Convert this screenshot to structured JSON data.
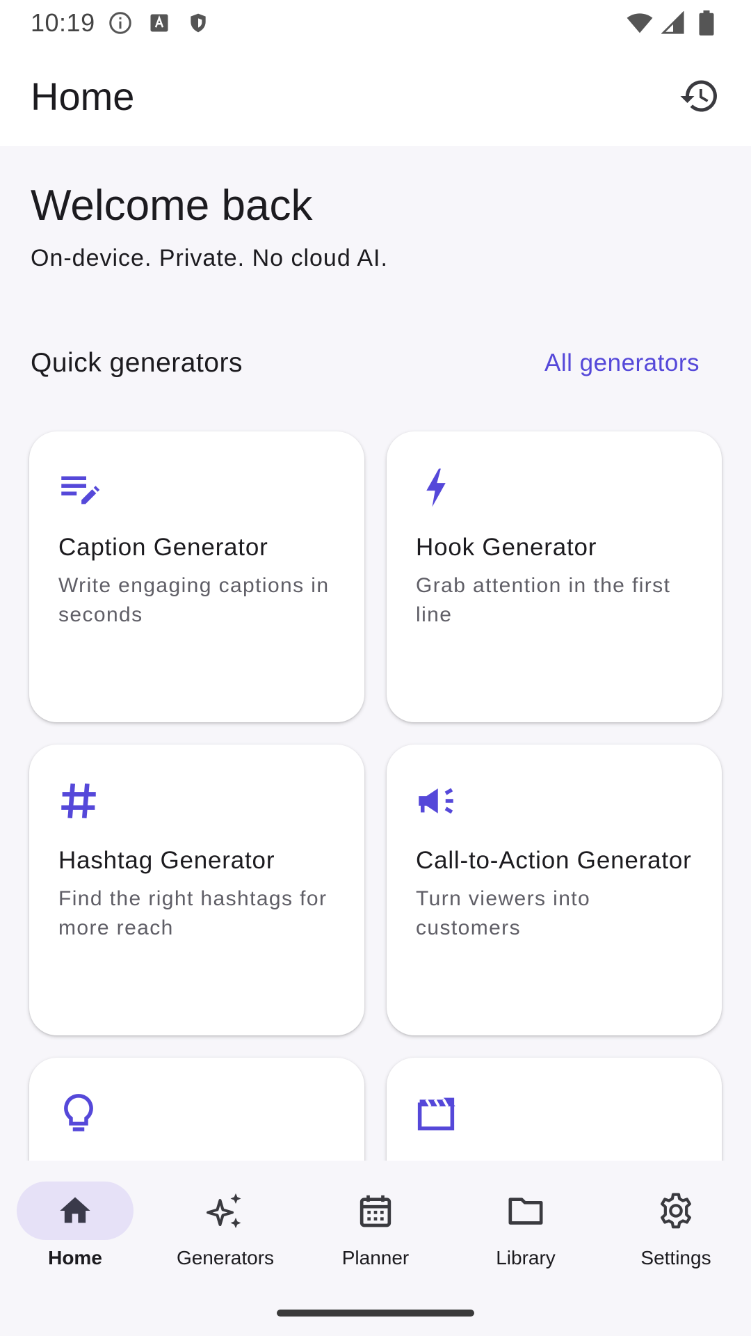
{
  "status_bar": {
    "time": "10:19",
    "icons": [
      "info-icon",
      "a-badge-icon",
      "shield-icon",
      "wifi-icon",
      "signal-icon",
      "battery-icon"
    ]
  },
  "app_bar": {
    "title": "Home",
    "action_icon": "history-icon"
  },
  "welcome": {
    "title": "Welcome back",
    "subtitle": "On-device. Private. No cloud AI."
  },
  "quick_generators": {
    "title": "Quick generators",
    "link": "All generators",
    "cards": [
      {
        "icon": "edit-notes-icon",
        "title": "Caption Generator",
        "description": "Write engaging captions in seconds"
      },
      {
        "icon": "bolt-icon",
        "title": "Hook Generator",
        "description": "Grab attention in the first line"
      },
      {
        "icon": "hashtag-icon",
        "title": "Hashtag Generator",
        "description": "Find the right hashtags for more reach"
      },
      {
        "icon": "campaign-icon",
        "title": "Call-to-Action Generator",
        "description": "Turn viewers into customers"
      },
      {
        "icon": "lightbulb-icon",
        "title": "",
        "description": ""
      },
      {
        "icon": "movie-icon",
        "title": "",
        "description": ""
      }
    ]
  },
  "bottom_nav": {
    "items": [
      {
        "label": "Home",
        "icon": "home-icon",
        "active": true
      },
      {
        "label": "Generators",
        "icon": "sparkle-icon",
        "active": false
      },
      {
        "label": "Planner",
        "icon": "calendar-icon",
        "active": false
      },
      {
        "label": "Library",
        "icon": "folder-icon",
        "active": false
      },
      {
        "label": "Settings",
        "icon": "gear-icon",
        "active": false
      }
    ]
  },
  "colors": {
    "accent": "#5548d9",
    "nav_active_pill": "#e6e1f7",
    "background": "#f7f6fa",
    "card": "#ffffff"
  }
}
